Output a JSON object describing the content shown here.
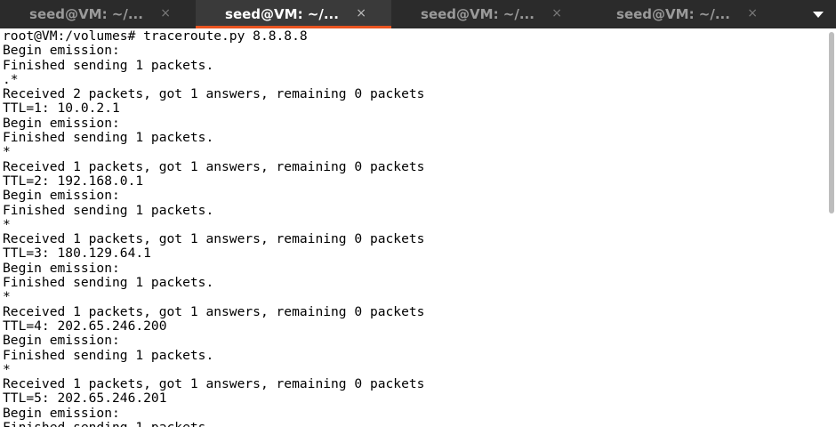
{
  "tabs": [
    {
      "label": "seed@VM: ~/...",
      "active": false
    },
    {
      "label": "seed@VM: ~/...",
      "active": true
    },
    {
      "label": "seed@VM: ~/...",
      "active": false
    },
    {
      "label": "seed@VM: ~/...",
      "active": false
    }
  ],
  "tab_close_glyph": "×",
  "colors": {
    "accent": "#e95420",
    "tabbar": "#2b2b2b",
    "active_tab": "#3a3a3a"
  },
  "terminal": {
    "lines": [
      "root@VM:/volumes# traceroute.py 8.8.8.8",
      "Begin emission:",
      "Finished sending 1 packets.",
      ".*",
      "Received 2 packets, got 1 answers, remaining 0 packets",
      "TTL=1: 10.0.2.1",
      "Begin emission:",
      "Finished sending 1 packets.",
      "*",
      "Received 1 packets, got 1 answers, remaining 0 packets",
      "TTL=2: 192.168.0.1",
      "Begin emission:",
      "Finished sending 1 packets.",
      "*",
      "Received 1 packets, got 1 answers, remaining 0 packets",
      "TTL=3: 180.129.64.1",
      "Begin emission:",
      "Finished sending 1 packets.",
      "*",
      "Received 1 packets, got 1 answers, remaining 0 packets",
      "TTL=4: 202.65.246.200",
      "Begin emission:",
      "Finished sending 1 packets.",
      "*",
      "Received 1 packets, got 1 answers, remaining 0 packets",
      "TTL=5: 202.65.246.201",
      "Begin emission:",
      "Finished sending 1 packets."
    ]
  },
  "icons": {
    "tab_menu": "chevron-down-icon",
    "tab_close": "close-icon"
  }
}
